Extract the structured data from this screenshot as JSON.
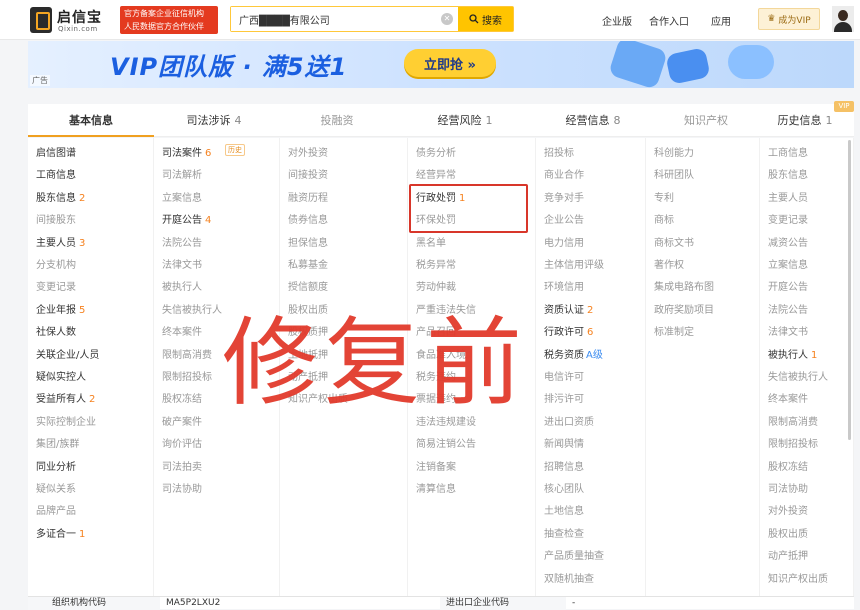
{
  "header": {
    "logo_name": "启信宝",
    "logo_sub": "Qixin.com",
    "auth_line1": "官方备案企业征信机构",
    "auth_line2": "人民数据官方合作伙伴",
    "search_value": "广西████有限公司",
    "search_button": "搜索",
    "nav": [
      "企业版",
      "合作入口",
      "应用"
    ],
    "vip_button": "成为VIP"
  },
  "banner": {
    "title": "VIP团队版 · 满5送1",
    "cta": "立即抢 »",
    "ad_label": "广告"
  },
  "tabs": [
    {
      "label": "基本信息",
      "count": "",
      "state": "active"
    },
    {
      "label": "司法涉诉",
      "count": "4",
      "state": "normal"
    },
    {
      "label": "投融资",
      "count": "",
      "state": "disabled"
    },
    {
      "label": "经营风险",
      "count": "1",
      "state": "normal"
    },
    {
      "label": "经营信息",
      "count": "8",
      "state": "normal"
    },
    {
      "label": "知识产权",
      "count": "",
      "state": "disabled"
    },
    {
      "label": "历史信息",
      "count": "1",
      "state": "normal"
    }
  ],
  "vip_tag": "VIP",
  "columns": [
    [
      {
        "t": "启信图谱",
        "c": "",
        "a": true
      },
      {
        "t": "工商信息",
        "c": "",
        "a": true
      },
      {
        "t": "股东信息",
        "c": "2",
        "a": true
      },
      {
        "t": "间接股东",
        "c": "",
        "a": false
      },
      {
        "t": "主要人员",
        "c": "3",
        "a": true
      },
      {
        "t": "分支机构",
        "c": "",
        "a": false
      },
      {
        "t": "变更记录",
        "c": "",
        "a": false
      },
      {
        "t": "企业年报",
        "c": "5",
        "a": true
      },
      {
        "t": "社保人数",
        "c": "",
        "a": true
      },
      {
        "t": "关联企业/人员",
        "c": "",
        "a": true
      },
      {
        "t": "疑似实控人",
        "c": "",
        "a": true
      },
      {
        "t": "受益所有人",
        "c": "2",
        "a": true
      },
      {
        "t": "实际控制企业",
        "c": "",
        "a": false
      },
      {
        "t": "集团/族群",
        "c": "",
        "a": false
      },
      {
        "t": "同业分析",
        "c": "",
        "a": true
      },
      {
        "t": "疑似关系",
        "c": "",
        "a": false
      },
      {
        "t": "品牌产品",
        "c": "",
        "a": false
      },
      {
        "t": "多证合一",
        "c": "1",
        "a": true
      }
    ],
    [
      {
        "t": "司法案件",
        "c": "6",
        "a": true
      },
      {
        "t": "司法解析",
        "c": "",
        "a": false
      },
      {
        "t": "立案信息",
        "c": "",
        "a": false
      },
      {
        "t": "开庭公告",
        "c": "4",
        "a": true
      },
      {
        "t": "法院公告",
        "c": "",
        "a": false
      },
      {
        "t": "法律文书",
        "c": "",
        "a": false
      },
      {
        "t": "被执行人",
        "c": "",
        "a": false
      },
      {
        "t": "失信被执行人",
        "c": "",
        "a": false
      },
      {
        "t": "终本案件",
        "c": "",
        "a": false
      },
      {
        "t": "限制高消费",
        "c": "",
        "a": false
      },
      {
        "t": "限制招投标",
        "c": "",
        "a": false
      },
      {
        "t": "股权冻结",
        "c": "",
        "a": false
      },
      {
        "t": "破产案件",
        "c": "",
        "a": false
      },
      {
        "t": "询价评估",
        "c": "",
        "a": false
      },
      {
        "t": "司法拍卖",
        "c": "",
        "a": false
      },
      {
        "t": "司法协助",
        "c": "",
        "a": false
      }
    ],
    [
      {
        "t": "对外投资",
        "c": "",
        "a": false
      },
      {
        "t": "间接投资",
        "c": "",
        "a": false
      },
      {
        "t": "融资历程",
        "c": "",
        "a": false
      },
      {
        "t": "债券信息",
        "c": "",
        "a": false
      },
      {
        "t": "担保信息",
        "c": "",
        "a": false
      },
      {
        "t": "私募基金",
        "c": "",
        "a": false
      },
      {
        "t": "授信额度",
        "c": "",
        "a": false
      },
      {
        "t": "股权出质",
        "c": "",
        "a": false
      },
      {
        "t": "股权质押",
        "c": "",
        "a": false
      },
      {
        "t": "土地抵押",
        "c": "",
        "a": false
      },
      {
        "t": "动产抵押",
        "c": "",
        "a": false
      },
      {
        "t": "知识产权出质",
        "c": "",
        "a": false
      }
    ],
    [
      {
        "t": "债务分析",
        "c": "",
        "a": false
      },
      {
        "t": "经营异常",
        "c": "",
        "a": false
      },
      {
        "t": "行政处罚",
        "c": "1",
        "a": true
      },
      {
        "t": "环保处罚",
        "c": "",
        "a": false
      },
      {
        "t": "黑名单",
        "c": "",
        "a": false
      },
      {
        "t": "税务异常",
        "c": "",
        "a": false
      },
      {
        "t": "劳动仲裁",
        "c": "",
        "a": false
      },
      {
        "t": "严重违法失信",
        "c": "",
        "a": false
      },
      {
        "t": "产品召回",
        "c": "",
        "a": false
      },
      {
        "t": "食品准入境",
        "c": "",
        "a": false
      },
      {
        "t": "税务违约",
        "c": "",
        "a": false
      },
      {
        "t": "票据违约",
        "c": "",
        "a": false
      },
      {
        "t": "违法违规建设",
        "c": "",
        "a": false
      },
      {
        "t": "简易注销公告",
        "c": "",
        "a": false
      },
      {
        "t": "注销备案",
        "c": "",
        "a": false
      },
      {
        "t": "清算信息",
        "c": "",
        "a": false
      }
    ],
    [
      {
        "t": "招投标",
        "c": "",
        "a": false
      },
      {
        "t": "商业合作",
        "c": "",
        "a": false
      },
      {
        "t": "竞争对手",
        "c": "",
        "a": false
      },
      {
        "t": "企业公告",
        "c": "",
        "a": false
      },
      {
        "t": "电力信用",
        "c": "",
        "a": false
      },
      {
        "t": "主体信用评级",
        "c": "",
        "a": false
      },
      {
        "t": "环境信用",
        "c": "",
        "a": false
      },
      {
        "t": "资质认证",
        "c": "2",
        "a": true
      },
      {
        "t": "行政许可",
        "c": "6",
        "a": true
      },
      {
        "t": "税务资质",
        "c": "",
        "lvl": "A级",
        "a": true
      },
      {
        "t": "电信许可",
        "c": "",
        "a": false
      },
      {
        "t": "排污许可",
        "c": "",
        "a": false
      },
      {
        "t": "进出口资质",
        "c": "",
        "a": false
      },
      {
        "t": "新闻舆情",
        "c": "",
        "a": false
      },
      {
        "t": "招聘信息",
        "c": "",
        "a": false
      },
      {
        "t": "核心团队",
        "c": "",
        "a": false
      },
      {
        "t": "土地信息",
        "c": "",
        "a": false
      },
      {
        "t": "抽查检查",
        "c": "",
        "a": false
      },
      {
        "t": "产品质量抽查",
        "c": "",
        "a": false
      },
      {
        "t": "双随机抽查",
        "c": "",
        "a": false
      }
    ],
    [
      {
        "t": "科创能力",
        "c": "",
        "a": false
      },
      {
        "t": "科研团队",
        "c": "",
        "a": false
      },
      {
        "t": "专利",
        "c": "",
        "a": false
      },
      {
        "t": "商标",
        "c": "",
        "a": false
      },
      {
        "t": "商标文书",
        "c": "",
        "a": false
      },
      {
        "t": "著作权",
        "c": "",
        "a": false
      },
      {
        "t": "集成电路布图",
        "c": "",
        "a": false
      },
      {
        "t": "政府奖励项目",
        "c": "",
        "a": false
      },
      {
        "t": "标准制定",
        "c": "",
        "a": false
      }
    ],
    [
      {
        "t": "工商信息",
        "c": "",
        "a": false
      },
      {
        "t": "股东信息",
        "c": "",
        "a": false
      },
      {
        "t": "主要人员",
        "c": "",
        "a": false
      },
      {
        "t": "变更记录",
        "c": "",
        "a": false
      },
      {
        "t": "减资公告",
        "c": "",
        "a": false
      },
      {
        "t": "立案信息",
        "c": "",
        "a": false
      },
      {
        "t": "开庭公告",
        "c": "",
        "a": false
      },
      {
        "t": "法院公告",
        "c": "",
        "a": false
      },
      {
        "t": "法律文书",
        "c": "",
        "a": false
      },
      {
        "t": "被执行人",
        "c": "1",
        "a": true
      },
      {
        "t": "失信被执行人",
        "c": "",
        "a": false
      },
      {
        "t": "终本案件",
        "c": "",
        "a": false
      },
      {
        "t": "限制高消费",
        "c": "",
        "a": false
      },
      {
        "t": "限制招投标",
        "c": "",
        "a": false
      },
      {
        "t": "股权冻结",
        "c": "",
        "a": false
      },
      {
        "t": "司法协助",
        "c": "",
        "a": false
      },
      {
        "t": "对外投资",
        "c": "",
        "a": false
      },
      {
        "t": "股权出质",
        "c": "",
        "a": false
      },
      {
        "t": "动产抵押",
        "c": "",
        "a": false
      },
      {
        "t": "知识产权出质",
        "c": "",
        "a": false
      }
    ]
  ],
  "history_tag": "历史",
  "overlay_text": "修复前",
  "bottom": {
    "org_code_label": "组织机构代码",
    "org_code_value": "MA5P2LXU2",
    "import_export_label": "进出口企业代码",
    "import_export_value": "-"
  },
  "colors": {
    "accent": "#ffc400",
    "count": "#f58220",
    "overlay": "#e23a2c",
    "banner": "#1b5fe0"
  }
}
